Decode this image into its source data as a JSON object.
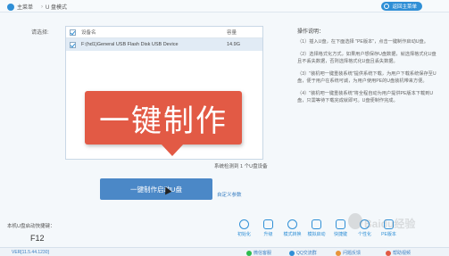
{
  "breadcrumb": {
    "home": "主菜单",
    "current": "U 盘模式"
  },
  "header": {
    "back_label": "返回主菜单"
  },
  "device_select": {
    "label": "请选择:",
    "columns": {
      "device": "设备名",
      "capacity": "容量"
    },
    "rows": [
      {
        "device": "F:(hd1)General USB Flash Disk USB Device",
        "capacity": "14.9G"
      }
    ],
    "detect_text": "系统检测到 1 个U盘设备"
  },
  "callout": {
    "text": "一键制作"
  },
  "help": {
    "title": "操作说明：",
    "items": [
      "（1）插入U盘，在下面选择 \"PE版本\"，点击一键制作启动U盘。",
      "（2）选择格式化方式，如果用户想保存U盘数据，就选择格式化U盘且不丢失数据，否则选择格式化U盘且丢失数据。",
      "（3）\"装机吧一键重装系统\"提供系统下载，为用户下载系统保存至U盘，便于用户在系统可诚，为用户使用PE的U盘装机带来方便。",
      "（4）\"装机吧一键重装系统\"将全程自动为用户提供PE版本下载到U盘，只需等待下载完成就即可。U盘便制作完成。"
    ]
  },
  "actions": {
    "make_label": "一键制作启动U盘",
    "custom_label": "自定义参数"
  },
  "hotkey": {
    "label": "本机U盘启动快捷键：",
    "value": "F12"
  },
  "tools": [
    {
      "label": "初始化",
      "icon": "undo-icon"
    },
    {
      "label": "升级",
      "icon": "upload-icon"
    },
    {
      "label": "模式转换",
      "icon": "convert-icon"
    },
    {
      "label": "模拟启动",
      "icon": "monitor-icon"
    },
    {
      "label": "快捷键",
      "icon": "keyboard-icon"
    },
    {
      "label": "个性化",
      "icon": "palette-icon"
    },
    {
      "label": "PE版本",
      "icon": "pe-icon"
    }
  ],
  "status": {
    "version": "VER[11.5.44.1230]",
    "wechat": "微信客服",
    "qq": "QQ交流群",
    "feedback": "问题反馈",
    "help": "帮助视频"
  },
  "watermark": "Baidu经验",
  "colors": {
    "accent": "#2f8fd6",
    "callout": "#e25a45",
    "button": "#4b88c7"
  }
}
